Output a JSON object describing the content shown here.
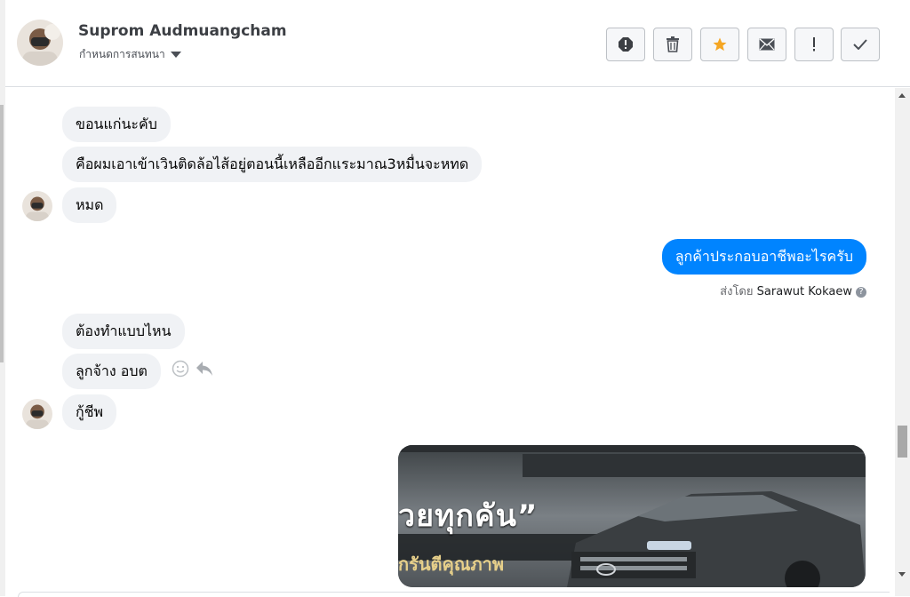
{
  "contact": {
    "name": "Suprom Audmuangcham",
    "subtitle": "กำหนดการสนทนา"
  },
  "toolbar": {
    "buttons": [
      {
        "name": "spam-button",
        "icon": "alert-circle-icon"
      },
      {
        "name": "delete-button",
        "icon": "trash-icon"
      },
      {
        "name": "star-button",
        "icon": "star-icon",
        "color": "#f5a623"
      },
      {
        "name": "mark-unread-button",
        "icon": "envelope-icon"
      },
      {
        "name": "mark-important-button",
        "icon": "exclamation-icon"
      },
      {
        "name": "mark-done-button",
        "icon": "check-icon"
      }
    ]
  },
  "messages": [
    {
      "from": "contact",
      "text": "ขอนแก่นะคับ"
    },
    {
      "from": "contact",
      "text": "คือผมเอาเข้าเวินติดล้อไส้อยู่ตอนนี้เหลืออีกแระมาณ3หมื่นจะหทด"
    },
    {
      "from": "contact",
      "text": "หมด"
    },
    {
      "from": "page",
      "text": "ลูกค้าประกอบอาชีพอะไรครับ"
    },
    {
      "from": "contact",
      "text": "ต้องทำแบบไหน"
    },
    {
      "from": "contact",
      "text": "ลูกจ้าง อบต"
    },
    {
      "from": "contact",
      "text": "กู้ชีพ"
    }
  ],
  "sent_by": {
    "prefix": "ส่งโดย",
    "name": "Sarawut Kokaew",
    "help": "?"
  },
  "image_message": {
    "overlay_line1": "วยทุกคัน”",
    "overlay_line2": "กรันตีคุณภาพ"
  },
  "colors": {
    "outgoing_bubble": "#0084ff",
    "incoming_bubble": "#f0f2f5",
    "star": "#f5a623"
  }
}
